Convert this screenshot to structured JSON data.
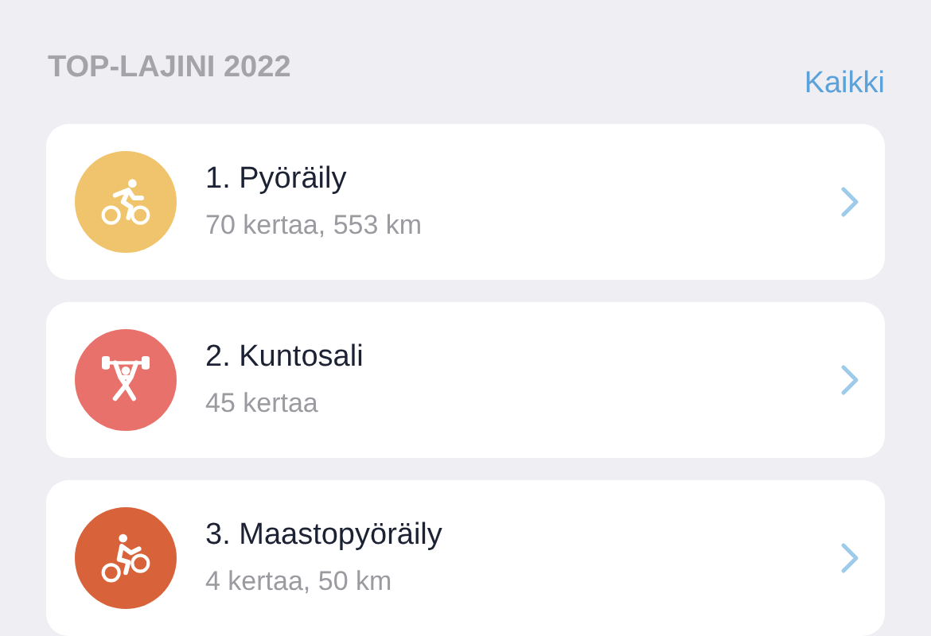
{
  "section": {
    "title": "TOP-LAJINI 2022",
    "link": "Kaikki"
  },
  "sports": [
    {
      "kind": "cycling",
      "color": "#f0c46c",
      "title": "1. Pyöräily",
      "stats": "70 kertaa, 553 km"
    },
    {
      "kind": "weightlifting",
      "color": "#e8716b",
      "title": "2. Kuntosali",
      "stats": "45 kertaa"
    },
    {
      "kind": "mountainbike",
      "color": "#d8633b",
      "title": "3. Maastopyöräily",
      "stats": "4 kertaa, 50 km"
    }
  ]
}
